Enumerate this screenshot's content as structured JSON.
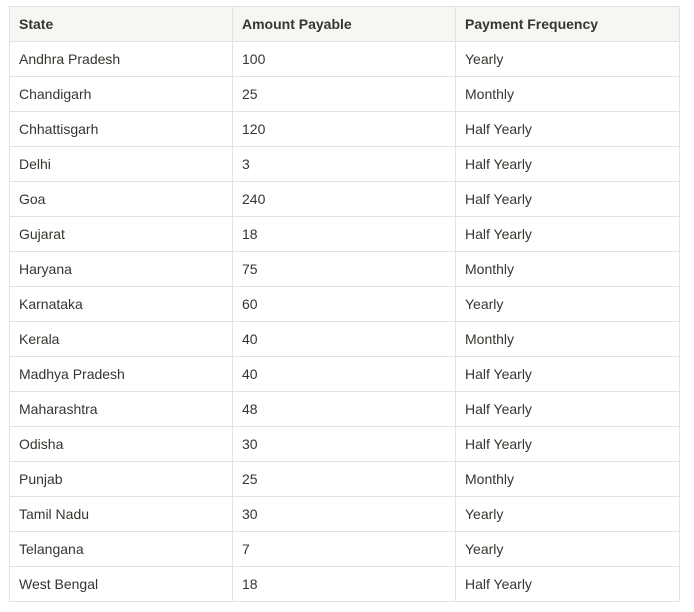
{
  "table": {
    "headers": [
      "State",
      "Amount Payable",
      "Payment Frequency"
    ],
    "rows": [
      [
        "Andhra Pradesh",
        "100",
        "Yearly"
      ],
      [
        "Chandigarh",
        "25",
        "Monthly"
      ],
      [
        "Chhattisgarh",
        "120",
        "Half Yearly"
      ],
      [
        "Delhi",
        "3",
        "Half Yearly"
      ],
      [
        "Goa",
        "240",
        "Half Yearly"
      ],
      [
        "Gujarat",
        "18",
        "Half Yearly"
      ],
      [
        "Haryana",
        "75",
        "Monthly"
      ],
      [
        "Karnataka",
        "60",
        "Yearly"
      ],
      [
        "Kerala",
        "40",
        "Monthly"
      ],
      [
        "Madhya Pradesh",
        "40",
        "Half Yearly"
      ],
      [
        "Maharashtra",
        "48",
        "Half Yearly"
      ],
      [
        "Odisha",
        "30",
        "Half Yearly"
      ],
      [
        "Punjab",
        "25",
        "Monthly"
      ],
      [
        "Tamil Nadu",
        "30",
        "Yearly"
      ],
      [
        "Telangana",
        "7",
        "Yearly"
      ],
      [
        "West Bengal",
        "18",
        "Half Yearly"
      ]
    ]
  }
}
